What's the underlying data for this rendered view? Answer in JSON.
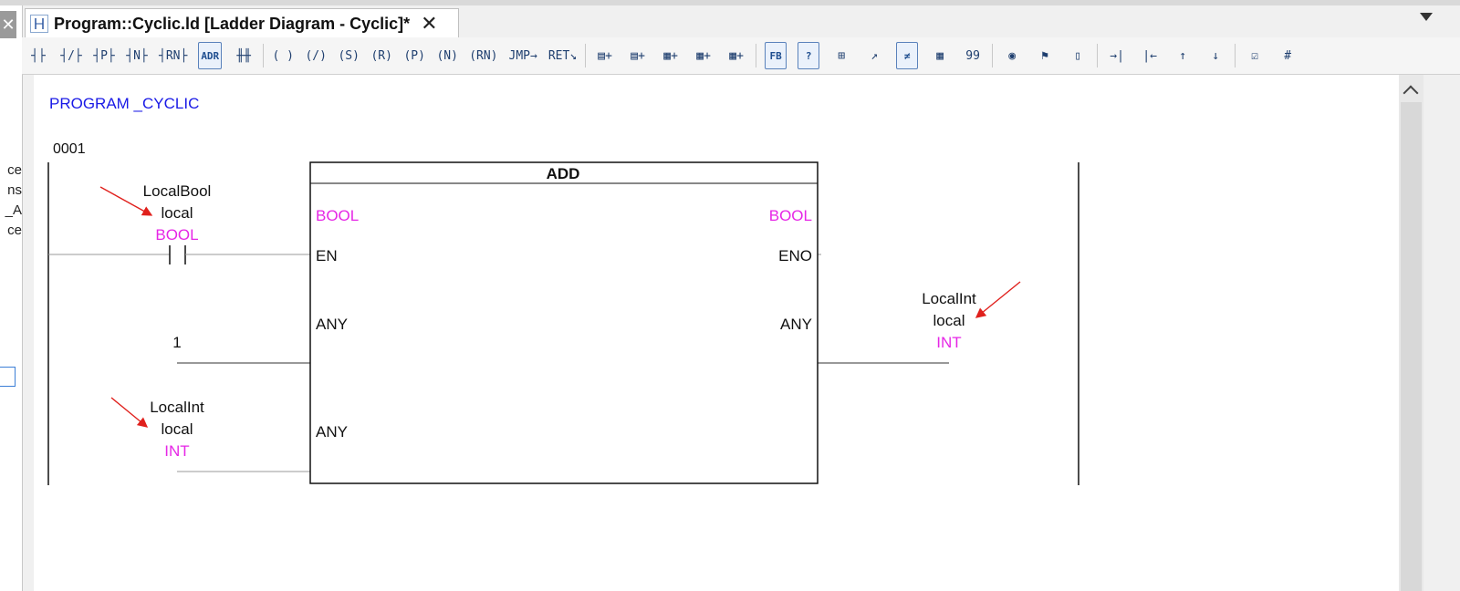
{
  "left_panel": {
    "close_glyph": "✕",
    "fragments": [
      "ce",
      "ns",
      "_A",
      "ce"
    ]
  },
  "tab": {
    "title": "Program::Cyclic.ld [Ladder Diagram - Cyclic]*",
    "close_glyph": "✕"
  },
  "toolbar": {
    "items": [
      {
        "name": "contact-icon",
        "text": "┤├"
      },
      {
        "name": "negated-contact-icon",
        "text": "┤/├"
      },
      {
        "name": "positive-transition-contact-icon",
        "text": "┤P├"
      },
      {
        "name": "negative-transition-contact-icon",
        "text": "┤N├"
      },
      {
        "name": "rising-negated-contact-icon",
        "text": "┤RN├"
      },
      {
        "name": "address-contact-icon",
        "text": "ADR",
        "boxed": true
      },
      {
        "name": "parallel-branch-icon",
        "text": "╫╫"
      },
      {
        "sep": true
      },
      {
        "name": "coil-icon",
        "text": "( )"
      },
      {
        "name": "negated-coil-icon",
        "text": "(/)"
      },
      {
        "name": "set-coil-icon",
        "text": "(S)"
      },
      {
        "name": "reset-coil-icon",
        "text": "(R)"
      },
      {
        "name": "positive-coil-icon",
        "text": "(P)"
      },
      {
        "name": "negative-coil-icon",
        "text": "(N)"
      },
      {
        "name": "rising-negated-coil-icon",
        "text": "(RN)"
      },
      {
        "name": "jump-icon",
        "text": "JMP→"
      },
      {
        "name": "return-icon",
        "text": "RET↘"
      },
      {
        "sep": true
      },
      {
        "name": "insert-network-above-icon",
        "text": "▤+"
      },
      {
        "name": "insert-network-below-icon",
        "text": "▤+"
      },
      {
        "name": "insert-column-icon",
        "text": "▦+"
      },
      {
        "name": "insert-row-icon",
        "text": "▦+"
      },
      {
        "name": "insert-cell-icon",
        "text": "▦+"
      },
      {
        "sep": true
      },
      {
        "name": "function-block-icon",
        "text": "FB",
        "boxed": true
      },
      {
        "name": "unknown-block-icon",
        "text": "?",
        "boxed": true
      },
      {
        "name": "block-connector-icon",
        "text": "⊞"
      },
      {
        "name": "block-jump-icon",
        "text": "↗"
      },
      {
        "name": "not-equal-icon",
        "text": "≠",
        "boxed": true
      },
      {
        "name": "calculator-icon",
        "text": "▦"
      },
      {
        "name": "literal-icon",
        "text": "99"
      },
      {
        "sep": true
      },
      {
        "name": "comment-icon",
        "text": "◉"
      },
      {
        "name": "flag-icon",
        "text": "⚑"
      },
      {
        "name": "page-icon",
        "text": "▯"
      },
      {
        "sep": true
      },
      {
        "name": "connect-right-icon",
        "text": "→|"
      },
      {
        "name": "connect-left-icon",
        "text": "|←"
      },
      {
        "name": "connect-up-icon",
        "text": "↑"
      },
      {
        "name": "connect-down-icon",
        "text": "↓"
      },
      {
        "sep": true
      },
      {
        "name": "check-icon",
        "text": "☑"
      },
      {
        "name": "grid-icon",
        "text": "#"
      }
    ]
  },
  "editor": {
    "program_header": "PROGRAM _CYCLIC",
    "network_number": "0001",
    "block": {
      "name": "ADD",
      "left_pins": [
        {
          "type": "BOOL",
          "name": "EN"
        },
        {
          "type": "",
          "name": "ANY"
        },
        {
          "type": "",
          "name": "ANY"
        }
      ],
      "right_pins": [
        {
          "type": "BOOL",
          "name": "ENO"
        },
        {
          "type": "",
          "name": "ANY"
        }
      ]
    },
    "contact": {
      "name": "LocalBool",
      "scope": "local",
      "type": "BOOL"
    },
    "constant_input": "1",
    "variable_input": {
      "name": "LocalInt",
      "scope": "local",
      "type": "INT"
    },
    "output": {
      "name": "LocalInt",
      "scope": "local",
      "type": "INT"
    }
  },
  "colors": {
    "keyword": "#1a1ae6",
    "type_label": "#e627e6",
    "annotation_arrow": "#e0201c"
  }
}
